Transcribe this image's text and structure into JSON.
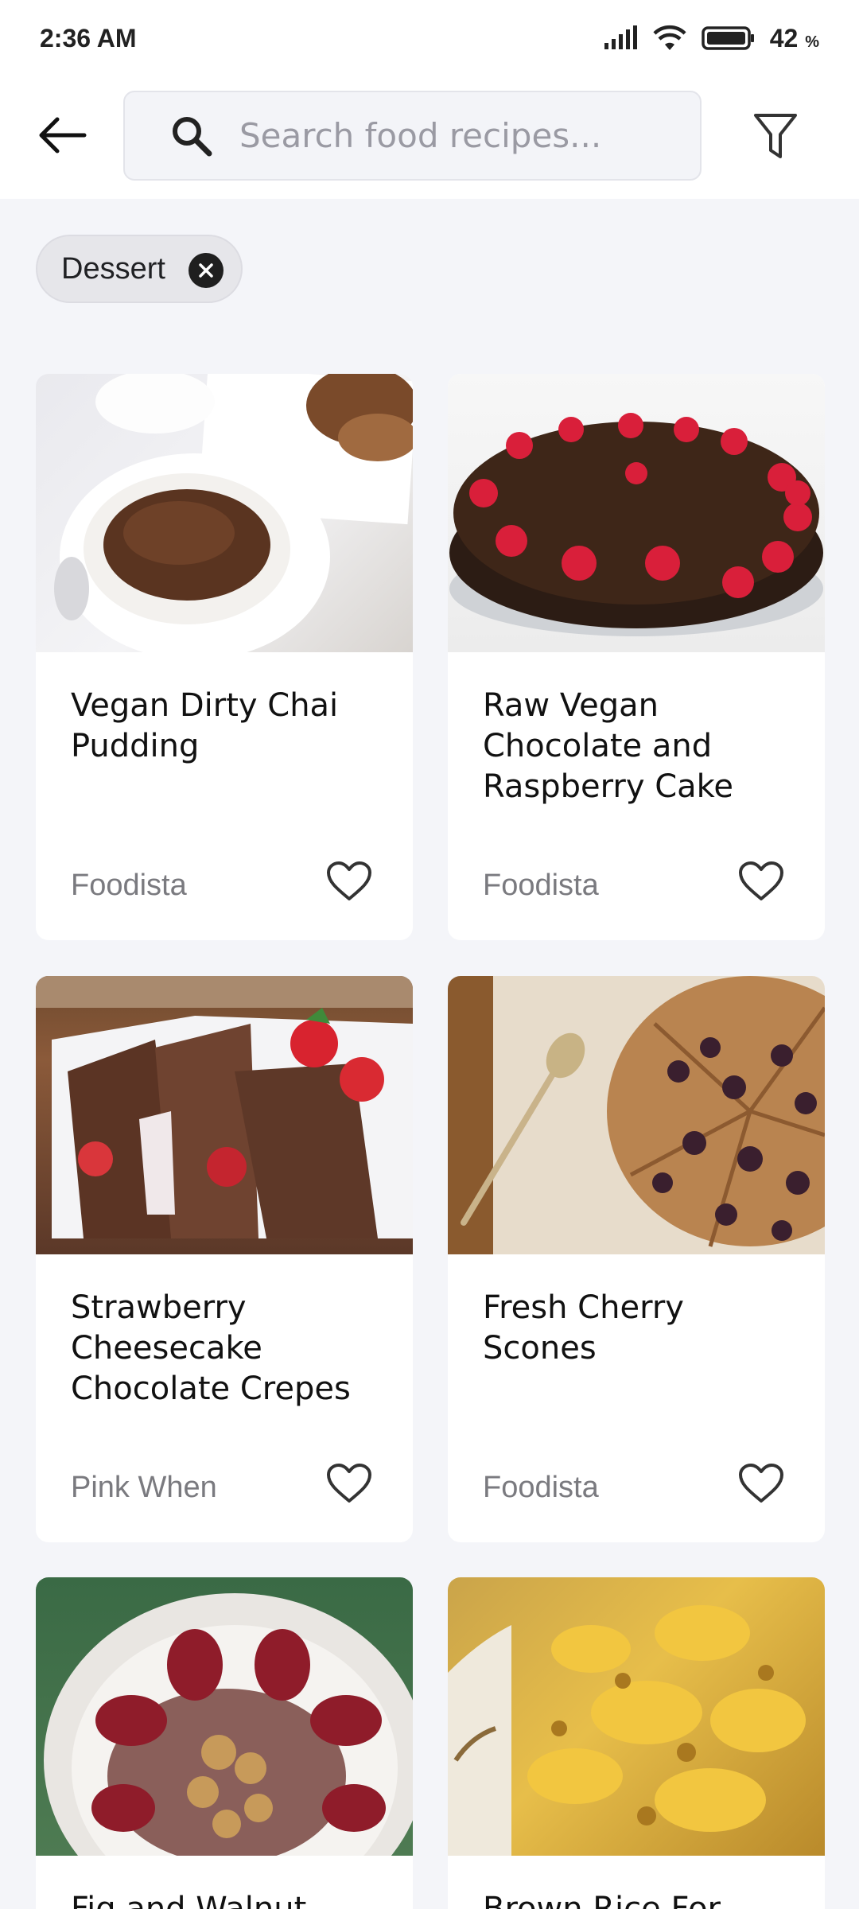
{
  "status_bar": {
    "time": "2:36 AM",
    "battery": "42",
    "battery_unit": "%"
  },
  "search": {
    "placeholder": "Search food recipes...",
    "value": ""
  },
  "filters": {
    "active_chip": "Dessert"
  },
  "icons": {
    "back": "arrow-back-icon",
    "search": "search-icon",
    "filter": "filter-funnel-icon",
    "chip_close": "close-circle-icon",
    "favorite": "heart-outline-icon"
  },
  "recipes": [
    {
      "title": "Vegan Dirty Chai Pudding",
      "source": "Foodista"
    },
    {
      "title": "Raw Vegan Chocolate and Raspberry Cake",
      "source": "Foodista"
    },
    {
      "title": "Strawberry Cheesecake Chocolate Crepes",
      "source": "Pink When"
    },
    {
      "title": "Fresh Cherry Scones",
      "source": "Foodista"
    },
    {
      "title": "Fig and Walnut",
      "source": ""
    },
    {
      "title": "Brown Rice For",
      "source": ""
    }
  ],
  "colors": {
    "background": "#f4f5f9",
    "card": "#ffffff",
    "text_primary": "#111111",
    "text_secondary": "#7a7a7f"
  }
}
